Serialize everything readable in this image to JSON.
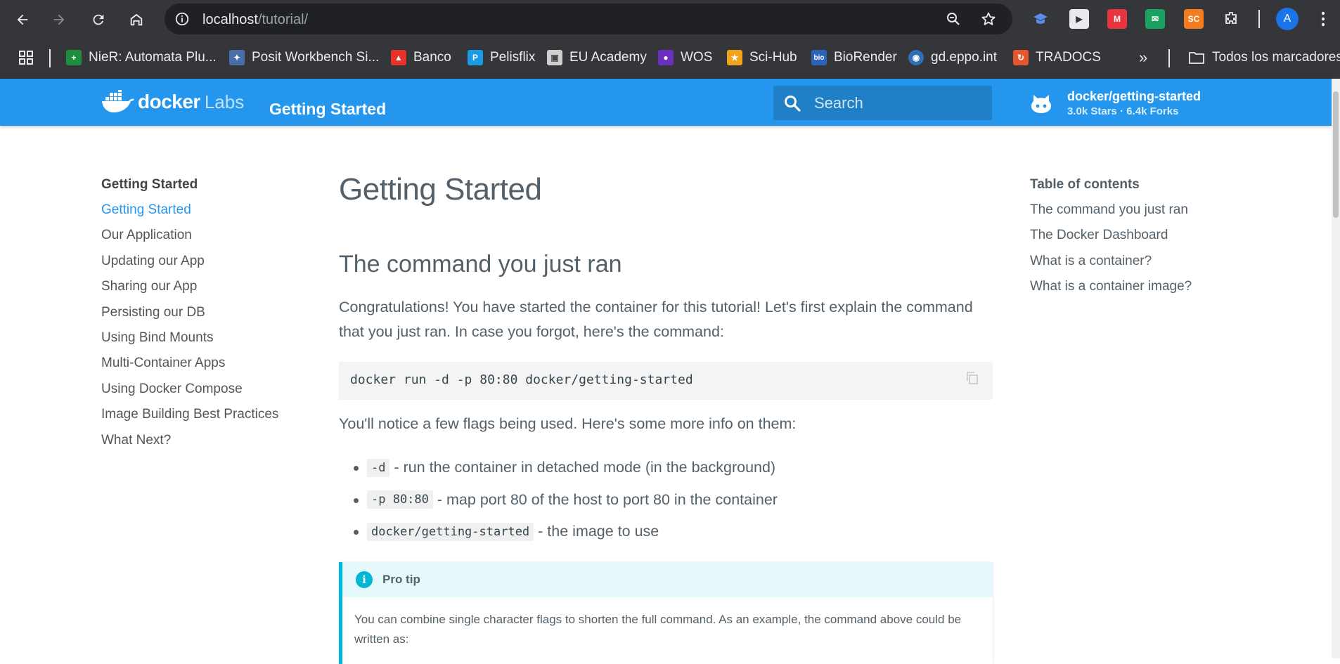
{
  "browser": {
    "url_host": "localhost",
    "url_path": "/tutorial/",
    "profile_initial": "A",
    "bookmarks": [
      {
        "label": "NieR: Automata Plu...",
        "icon": "plus-icon",
        "color": "#1e8e3e"
      },
      {
        "label": "Posit Workbench Si...",
        "icon": "posit-icon",
        "color": "#4a6ea9"
      },
      {
        "label": "Banco",
        "icon": "banco-icon",
        "color": "#e63329"
      },
      {
        "label": "Pelisflix",
        "icon": "pelisflix-icon",
        "color": "#1a9be6"
      },
      {
        "label": "EU Academy",
        "icon": "eu-academy-icon",
        "color": "#cfcfcf"
      },
      {
        "label": "WOS",
        "icon": "wos-icon",
        "color": "#6a2fbf"
      },
      {
        "label": "Sci-Hub",
        "icon": "scihub-icon",
        "color": "#f2a31d"
      },
      {
        "label": "BioRender",
        "icon": "biorender-icon",
        "color": "#2a63b8"
      },
      {
        "label": "gd.eppo.int",
        "icon": "eppo-icon",
        "color": "#2f6fb5"
      },
      {
        "label": "TRADOCS",
        "icon": "tradocs-icon",
        "color": "#e4572e"
      }
    ],
    "all_bookmarks": "Todos los marcadores",
    "search_placeholder": "Search"
  },
  "header": {
    "logo_word1": "docker",
    "logo_word2": "Labs",
    "site_title": "Getting Started",
    "repo_name": "docker/getting-started",
    "repo_facts": "3.0k Stars · 6.4k Forks"
  },
  "leftnav": {
    "title": "Getting Started",
    "items": [
      "Getting Started",
      "Our Application",
      "Updating our App",
      "Sharing our App",
      "Persisting our DB",
      "Using Bind Mounts",
      "Multi-Container Apps",
      "Using Docker Compose",
      "Image Building Best Practices",
      "What Next?"
    ]
  },
  "main": {
    "h1": "Getting Started",
    "h2": "The command you just ran",
    "p1": "Congratulations! You have started the container for this tutorial! Let's first explain the command that you just ran. In case you forgot, here's the command:",
    "command": "docker run -d -p 80:80 docker/getting-started",
    "p2": "You'll notice a few flags being used. Here's some more info on them:",
    "flags": [
      {
        "code": "-d",
        "text": "- run the container in detached mode (in the background)"
      },
      {
        "code": "-p 80:80",
        "text": "- map port 80 of the host to port 80 in the container"
      },
      {
        "code": "docker/getting-started",
        "text": "- the image to use"
      }
    ],
    "tip_label": "Pro tip",
    "tip_body": "You can combine single character flags to shorten the full command. As an example, the command above could be written as:"
  },
  "toc": {
    "title": "Table of contents",
    "items": [
      "The command you just ran",
      "The Docker Dashboard",
      "What is a container?",
      "What is a container image?"
    ]
  }
}
